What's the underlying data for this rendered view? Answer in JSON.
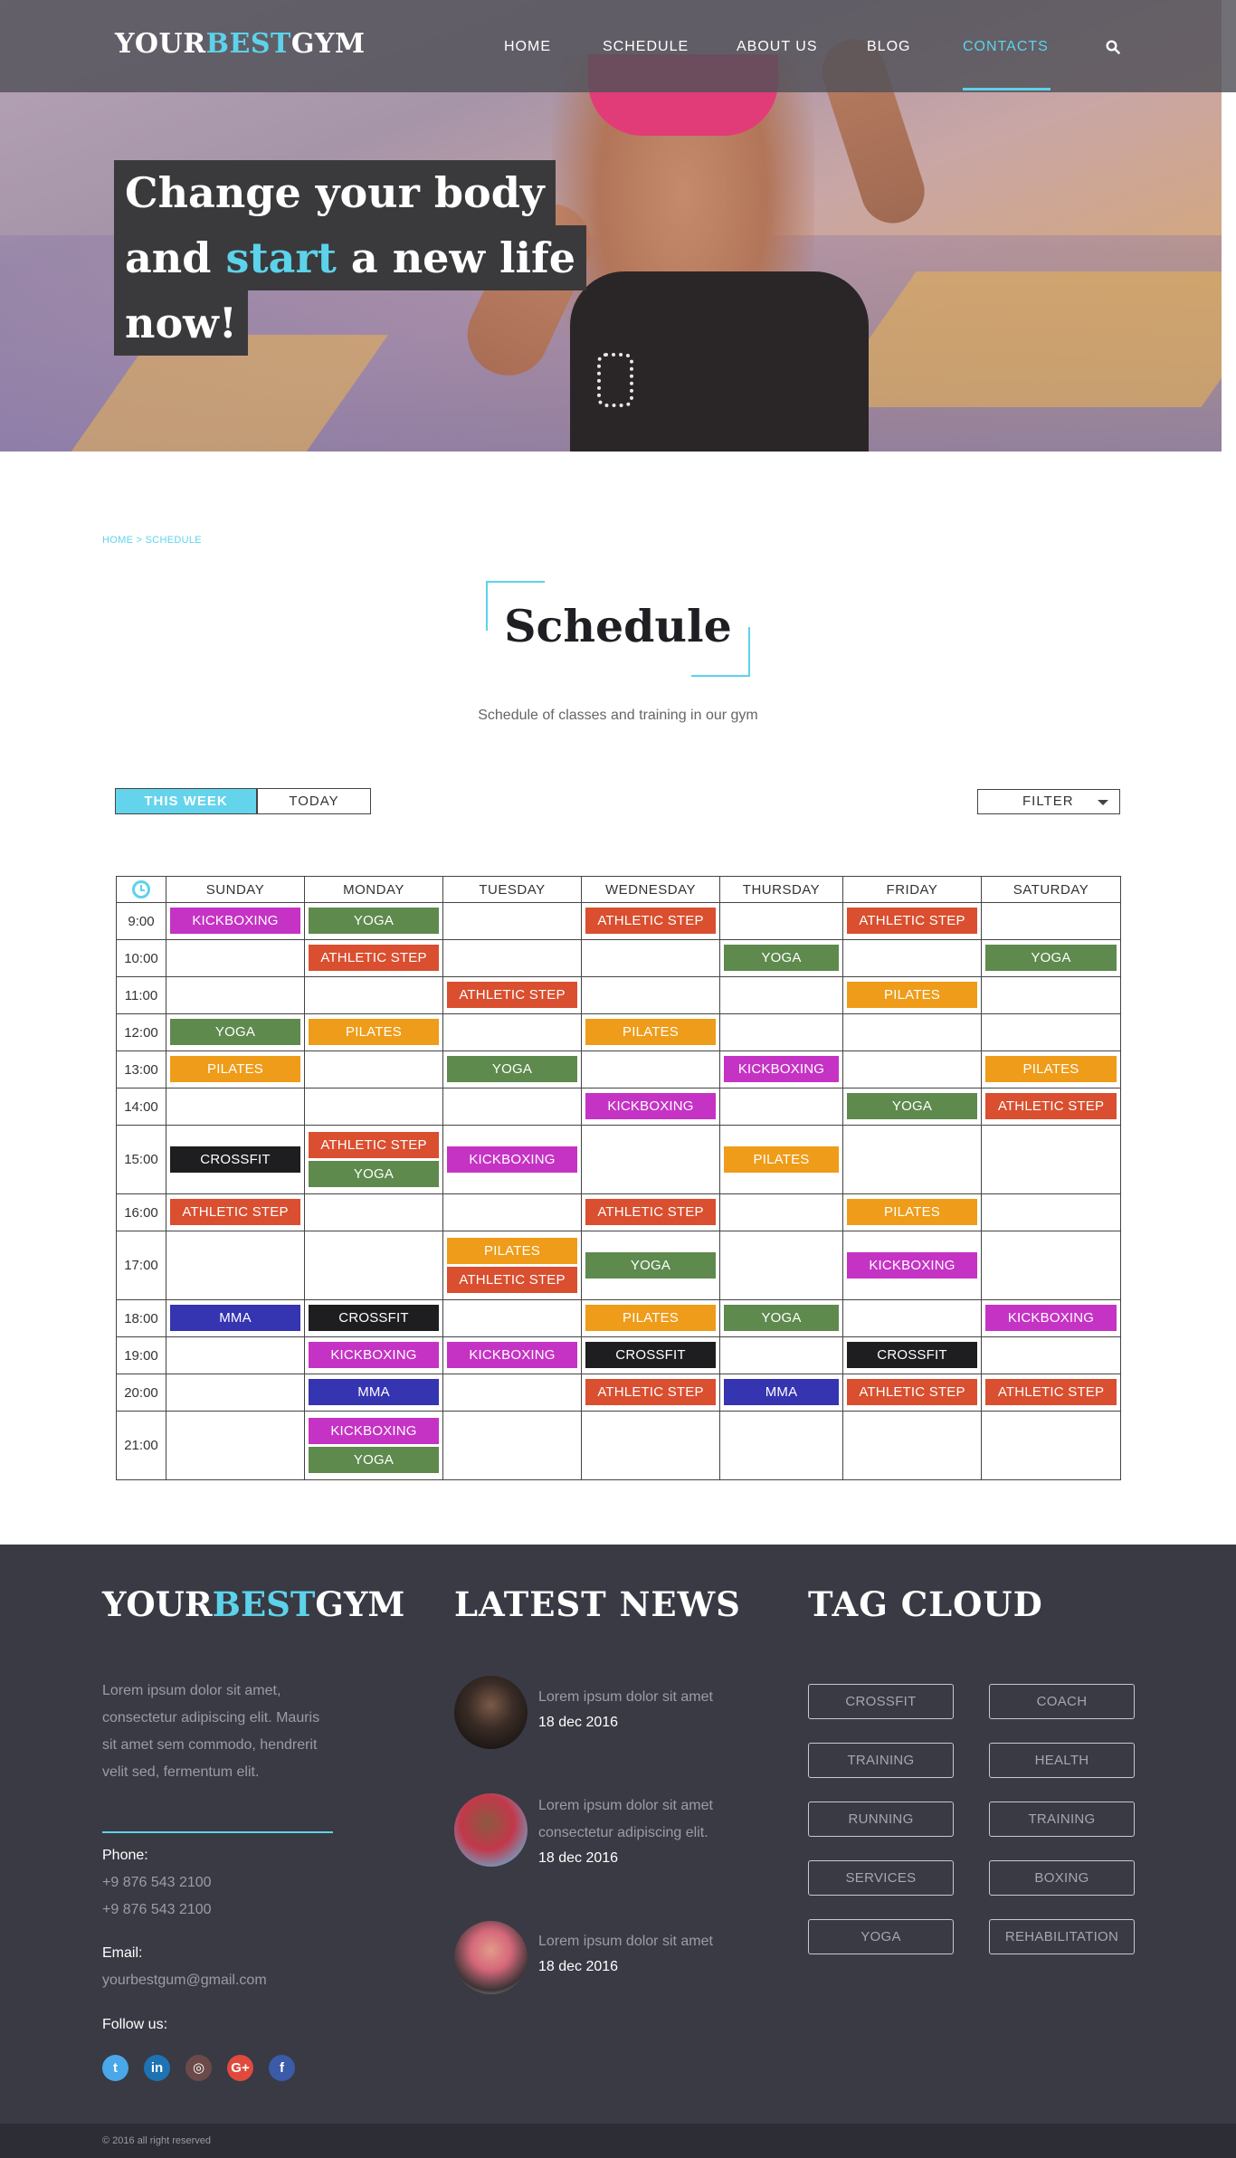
{
  "header": {
    "logo": {
      "part1": "YOUR",
      "part2": "BEST",
      "part3": "GYM"
    },
    "nav": [
      {
        "label": "HOME",
        "active": false
      },
      {
        "label": "SCHEDULE",
        "active": false
      },
      {
        "label": "ABOUT US",
        "active": false
      },
      {
        "label": "BLOG",
        "active": false
      },
      {
        "label": "CONTACTS",
        "active": true
      }
    ],
    "search_icon": "search-icon"
  },
  "hero": {
    "line1": "Change your body",
    "line2_pre": "and ",
    "line2_accent": "start",
    "line2_post": " a new life",
    "line3": "now!"
  },
  "schedule": {
    "breadcrumb": "HOME > SCHEDULE",
    "title": "Schedule",
    "subtitle": "Schedule of classes and training in our gym",
    "btn_week": "THIS WEEK",
    "btn_today": "TODAY",
    "btn_filter": "FILTER",
    "days": [
      "SUNDAY",
      "MONDAY",
      "TUESDAY",
      "WEDNESDAY",
      "THURSDAY",
      "FRIDAY",
      "SATURDAY"
    ],
    "colors": {
      "KICKBOXING": "#c533c4",
      "YOGA": "#5e8a4e",
      "ATHLETIC STEP": "#d94f2f",
      "PILATES": "#ee9c19",
      "CROSSFIT": "#1e1e20",
      "MMA": "#3534b1"
    },
    "rows": [
      {
        "time": "9:00",
        "cells": [
          [
            "KICKBOXING"
          ],
          [
            "YOGA"
          ],
          [],
          [
            "ATHLETIC STEP"
          ],
          [],
          [
            "ATHLETIC STEP"
          ],
          []
        ]
      },
      {
        "time": "10:00",
        "cells": [
          [],
          [
            "ATHLETIC STEP"
          ],
          [],
          [],
          [
            "YOGA"
          ],
          [],
          [
            "YOGA"
          ]
        ]
      },
      {
        "time": "11:00",
        "cells": [
          [],
          [],
          [
            "ATHLETIC STEP"
          ],
          [],
          [],
          [
            "PILATES"
          ],
          []
        ]
      },
      {
        "time": "12:00",
        "cells": [
          [
            "YOGA"
          ],
          [
            "PILATES"
          ],
          [],
          [
            "PILATES"
          ],
          [],
          [],
          []
        ]
      },
      {
        "time": "13:00",
        "cells": [
          [
            "PILATES"
          ],
          [],
          [
            "YOGA"
          ],
          [],
          [
            "KICKBOXING"
          ],
          [],
          [
            "PILATES"
          ]
        ]
      },
      {
        "time": "14:00",
        "cells": [
          [],
          [],
          [],
          [
            "KICKBOXING"
          ],
          [],
          [
            "YOGA"
          ],
          [
            "ATHLETIC STEP"
          ]
        ]
      },
      {
        "time": "15:00",
        "cells": [
          [
            "CROSSFIT"
          ],
          [
            "ATHLETIC STEP",
            "YOGA"
          ],
          [
            "KICKBOXING"
          ],
          [],
          [
            "PILATES"
          ],
          [],
          []
        ]
      },
      {
        "time": "16:00",
        "cells": [
          [
            "ATHLETIC STEP"
          ],
          [],
          [],
          [
            "ATHLETIC STEP"
          ],
          [],
          [
            "PILATES"
          ],
          []
        ]
      },
      {
        "time": "17:00",
        "cells": [
          [],
          [],
          [
            "PILATES",
            "ATHLETIC STEP"
          ],
          [
            "YOGA"
          ],
          [],
          [
            "KICKBOXING"
          ],
          []
        ]
      },
      {
        "time": "18:00",
        "cells": [
          [
            "MMA"
          ],
          [
            "CROSSFIT"
          ],
          [],
          [
            "PILATES"
          ],
          [
            "YOGA"
          ],
          [],
          [
            "KICKBOXING"
          ]
        ]
      },
      {
        "time": "19:00",
        "cells": [
          [],
          [
            "KICKBOXING"
          ],
          [
            "KICKBOXING"
          ],
          [
            "CROSSFIT"
          ],
          [],
          [
            "CROSSFIT"
          ],
          []
        ]
      },
      {
        "time": "20:00",
        "cells": [
          [],
          [
            "MMA"
          ],
          [],
          [
            "ATHLETIC STEP"
          ],
          [
            "MMA"
          ],
          [
            "ATHLETIC STEP"
          ],
          [
            "ATHLETIC STEP"
          ]
        ]
      },
      {
        "time": "21:00",
        "cells": [
          [],
          [
            "KICKBOXING",
            "YOGA"
          ],
          [],
          [],
          [],
          [],
          []
        ]
      }
    ]
  },
  "footer": {
    "logo": {
      "part1": "YOUR",
      "part2": "BEST",
      "part3": "GYM"
    },
    "about": "Lorem ipsum dolor sit amet, consectetur adipiscing elit. Mauris sit amet sem commodo, hendrerit velit sed, fermentum elit.",
    "phone_label": "Phone:",
    "phone1": "+9 876 543 2100",
    "phone2": "+9 876 543 2100",
    "email_label": "Email:",
    "email": "yourbestgum@gmail.com",
    "follow_label": "Follow us:",
    "social": [
      {
        "name": "twitter-icon",
        "glyph": "t",
        "color": "#4aa7e8"
      },
      {
        "name": "linkedin-icon",
        "glyph": "in",
        "color": "#1d73b3"
      },
      {
        "name": "instagram-icon",
        "glyph": "◎",
        "color": "#6c4a4a"
      },
      {
        "name": "google-plus-icon",
        "glyph": "G+",
        "color": "#e04a3c"
      },
      {
        "name": "facebook-icon",
        "glyph": "f",
        "color": "#3b5ba8"
      }
    ],
    "news_title": "LATEST NEWS",
    "news": [
      {
        "text": "Lorem ipsum dolor sit amet",
        "date": "18 dec 2016"
      },
      {
        "text": "Lorem ipsum dolor sit amet consectetur adipiscing elit.",
        "date": "18 dec 2016"
      },
      {
        "text": "Lorem ipsum dolor sit amet",
        "date": "18 dec 2016"
      }
    ],
    "tags_title": "TAG CLOUD",
    "tags": [
      "CROSSFIT",
      "COACH",
      "TRAINING",
      "HEALTH",
      "RUNNING",
      "TRAINING",
      "SERVICES",
      "BOXING",
      "YOGA",
      "REHABILITATION"
    ],
    "copyright": "© 2016 all right reserved"
  }
}
